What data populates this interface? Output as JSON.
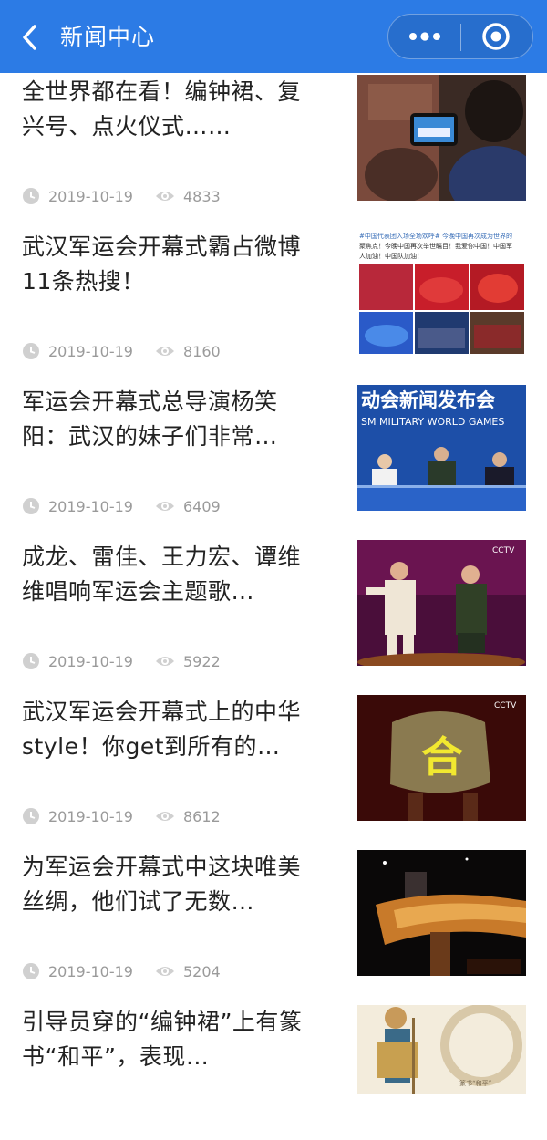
{
  "header": {
    "title": "新闻中心",
    "background": "#2c7be5",
    "back_icon": "chevron-left-icon",
    "more_icon": "more-icon",
    "close_icon": "target-icon"
  },
  "news": [
    {
      "title": "全世界都在看！编钟裙、复兴号、点火仪式……",
      "date": "2019-10-19",
      "views": "4833"
    },
    {
      "title": "武汉军运会开幕式霸占微博11条热搜！",
      "date": "2019-10-19",
      "views": "8160"
    },
    {
      "title": "军运会开幕式总导演杨笑阳：武汉的妹子们非常…",
      "date": "2019-10-19",
      "views": "6409"
    },
    {
      "title": "成龙、雷佳、王力宏、谭维维唱响军运会主题歌…",
      "date": "2019-10-19",
      "views": "5922"
    },
    {
      "title": "武汉军运会开幕式上的中华style！你get到所有的…",
      "date": "2019-10-19",
      "views": "8612"
    },
    {
      "title": "为军运会开幕式中这块唯美丝绸，他们试了无数…",
      "date": "2019-10-19",
      "views": "5204"
    },
    {
      "title": "引导员穿的“编钟裙”上有篆书“和平”，表现…",
      "date": "",
      "views": ""
    }
  ],
  "thumb_text": {
    "t2_line1": "#中国代表团入场全场欢呼# 今晚中国再次成为世界的",
    "t2_line2": "聚焦点！今晚中国再次举世瞩目！我爱你中国！中国军",
    "t2_line3": "人加油！中国队加油！",
    "t3_banner": "动会新闻发布会",
    "t3_sub": "SM MILITARY WORLD GAMES",
    "t4_logo": "CCTV",
    "t5_logo": "CCTV",
    "t5_glyph": "合",
    "t7_caption": "篆书“和平”"
  }
}
